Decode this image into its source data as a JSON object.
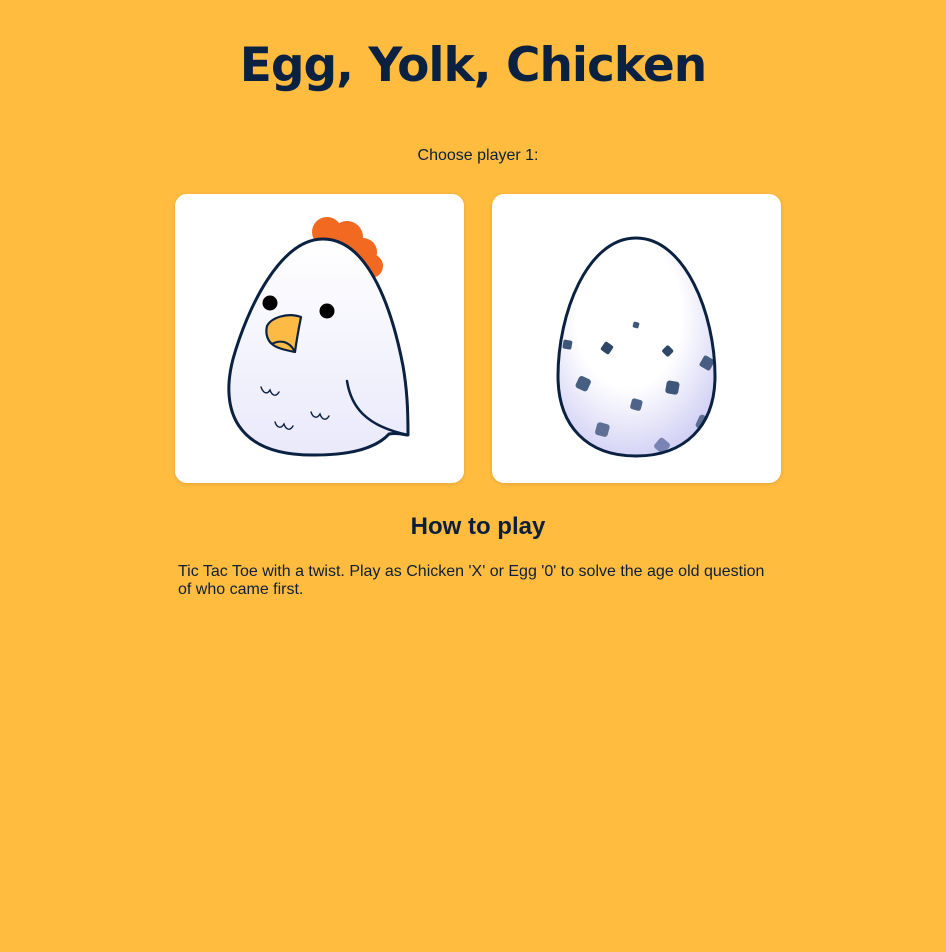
{
  "header": {
    "title": "Egg, Yolk, Chicken"
  },
  "selection": {
    "prompt": "Choose player 1:",
    "options": [
      {
        "icon": "chicken-icon",
        "player": "Chicken"
      },
      {
        "icon": "egg-icon",
        "player": "Egg"
      }
    ]
  },
  "how_to_play": {
    "heading": "How to play",
    "text": "Tic Tac Toe with a twist. Play as Chicken 'X' or Egg '0' to solve the age old question of who came first."
  },
  "colors": {
    "background": "#FFBC3F",
    "text": "#0B1E3A",
    "card": "#FFFFFF",
    "comb": "#F26A21",
    "beak": "#FDBB45"
  }
}
